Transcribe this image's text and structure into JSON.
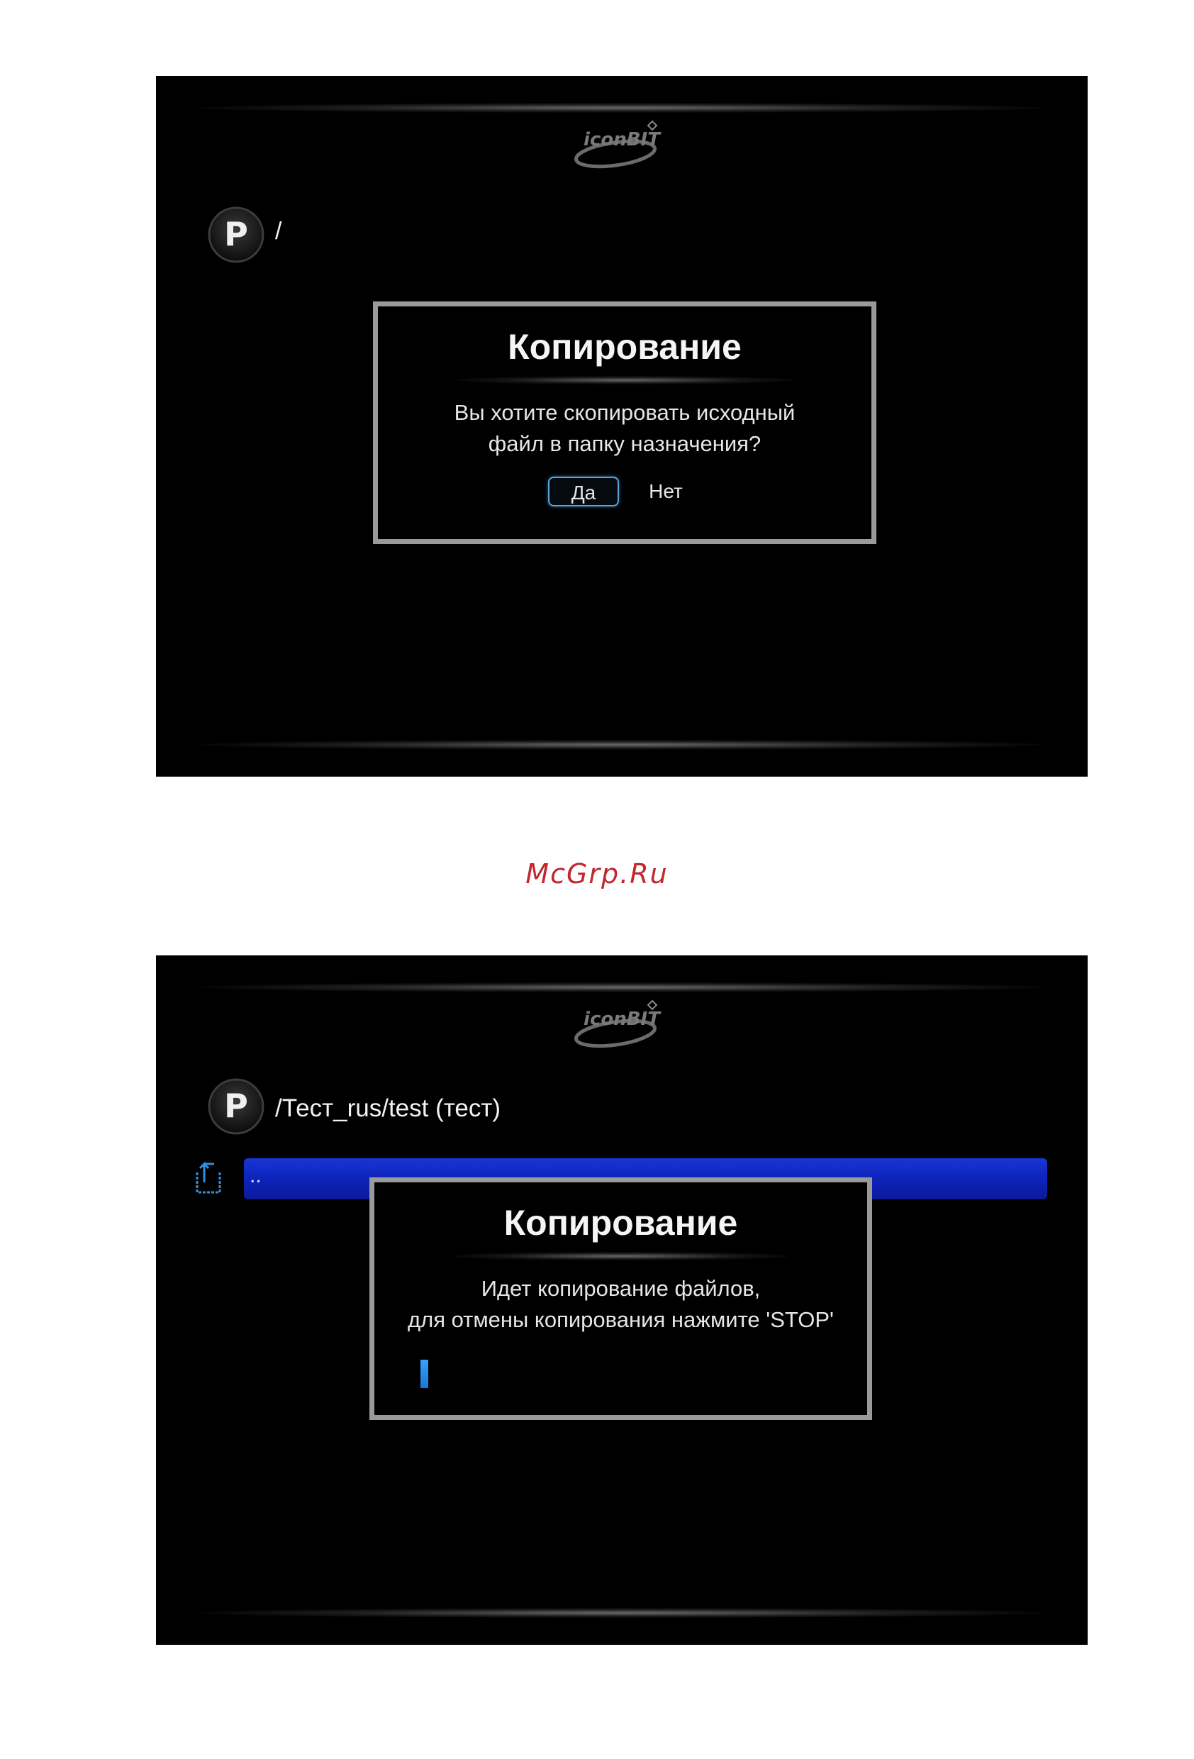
{
  "screens": [
    {
      "logo_text": "iconBIT",
      "badge_letter": "P",
      "path": "/",
      "dialog": {
        "title": "Копирование",
        "message_lines": [
          "Вы хотите скопировать исходный",
          "файл в папку назначения?"
        ],
        "buttons": [
          {
            "label": "Да",
            "selected": true
          },
          {
            "label": "Нет",
            "selected": false
          }
        ]
      }
    },
    {
      "logo_text": "iconBIT",
      "badge_letter": "P",
      "path": "/Тест_rus/test (тест)",
      "list": {
        "selected_item": "..",
        "item_icon": "folder-up-icon"
      },
      "dialog": {
        "title": "Копирование",
        "message_lines": [
          "Идет копирование файлов,",
          "для отмены копирования нажмите 'STOP'"
        ],
        "progress_percent": 2
      }
    }
  ],
  "watermark": "McGrp.Ru",
  "colors": {
    "screen_background": "#000000",
    "dialog_border": "#9a9a9a",
    "selection_blue": "#1736d6",
    "focus_outline": "#5fa3d6",
    "progress_blue": "#1678d6",
    "watermark_red": "#c0282d"
  }
}
